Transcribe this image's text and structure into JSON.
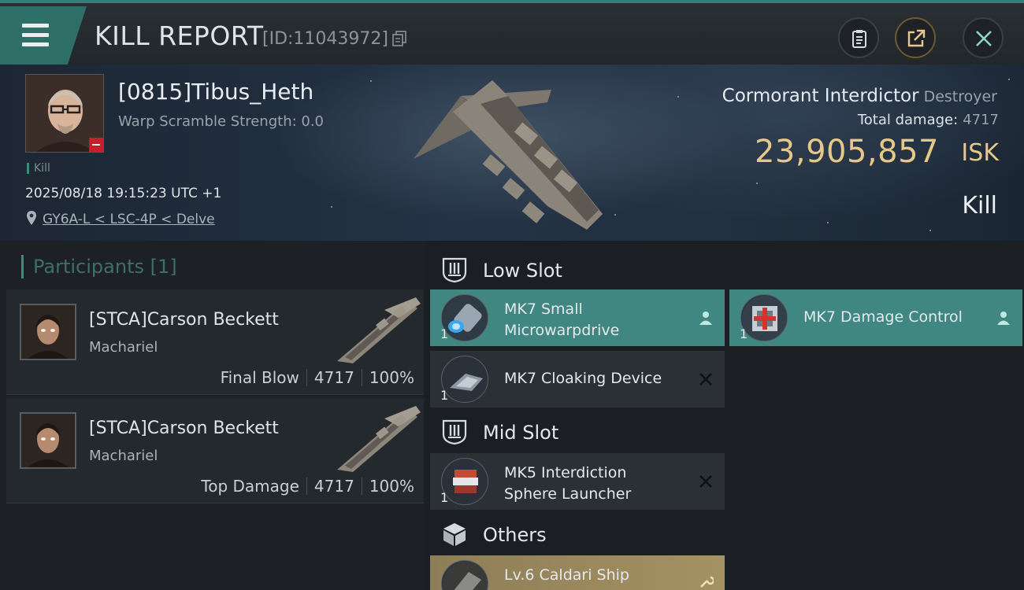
{
  "header": {
    "title": "KILL REPORT",
    "report_id": "[ID:11043972]"
  },
  "victim": {
    "name": "[0815]Tibus_Heth",
    "warp_scramble": "Warp Scramble Strength: 0.0",
    "tag": "Kill",
    "timestamp": "2025/08/18 19:15:23 UTC +1",
    "location": "GY6A-L < LSC-4P < Delve"
  },
  "ship": {
    "name": "Cormorant Interdictor",
    "class": "Destroyer",
    "total_damage_label": "Total damage:",
    "total_damage_value": "4717",
    "isk_value": "23,905,857",
    "isk_unit": "ISK",
    "outcome": "Kill"
  },
  "participants": {
    "header": "Participants [1]",
    "rows": [
      {
        "name": "[STCA]Carson Beckett",
        "ship": "Machariel",
        "role": "Final Blow",
        "damage": "4717",
        "percent": "100%"
      },
      {
        "name": "[STCA]Carson Beckett",
        "ship": "Machariel",
        "role": "Top Damage",
        "damage": "4717",
        "percent": "100%"
      }
    ]
  },
  "fittings": {
    "low_slot": {
      "title": "Low Slot",
      "modules": [
        {
          "name": "MK7 Small Microwarpdrive",
          "line1": "MK7 Small",
          "line2": "Microwarpdrive",
          "qty": "1",
          "status": "dropped",
          "color": "#3f8780"
        },
        {
          "name": "MK7 Damage Control",
          "qty": "1",
          "status": "dropped",
          "color": "#3f8780"
        },
        {
          "name": "MK7 Cloaking Device",
          "qty": "1",
          "status": "destroyed",
          "color": "#2b3035"
        }
      ]
    },
    "mid_slot": {
      "title": "Mid Slot",
      "modules": [
        {
          "name": "MK5 Interdiction Sphere Launcher",
          "line1": "MK5 Interdiction",
          "line2": "Sphere Launcher",
          "qty": "1",
          "status": "destroyed",
          "color": "#2b3035"
        }
      ]
    },
    "others": {
      "title": "Others",
      "modules": [
        {
          "name": "Lv.6 Caldari Ship",
          "qty": "",
          "status": "dropped",
          "color": "#a08f5f"
        }
      ]
    }
  },
  "colors": {
    "accent_teal": "#3f8780",
    "isk_gold": "#e6c989",
    "loss_red": "#c4202a"
  },
  "icons": {
    "menu": "hamburger-icon",
    "copy": "copy-icon",
    "clipboard": "clipboard-icon",
    "share": "share-icon",
    "close": "close-icon",
    "location": "location-pin-icon",
    "slot": "shield-slot-icon",
    "others": "cube-icon",
    "dropped": "person-icon",
    "destroyed": "x-icon"
  }
}
